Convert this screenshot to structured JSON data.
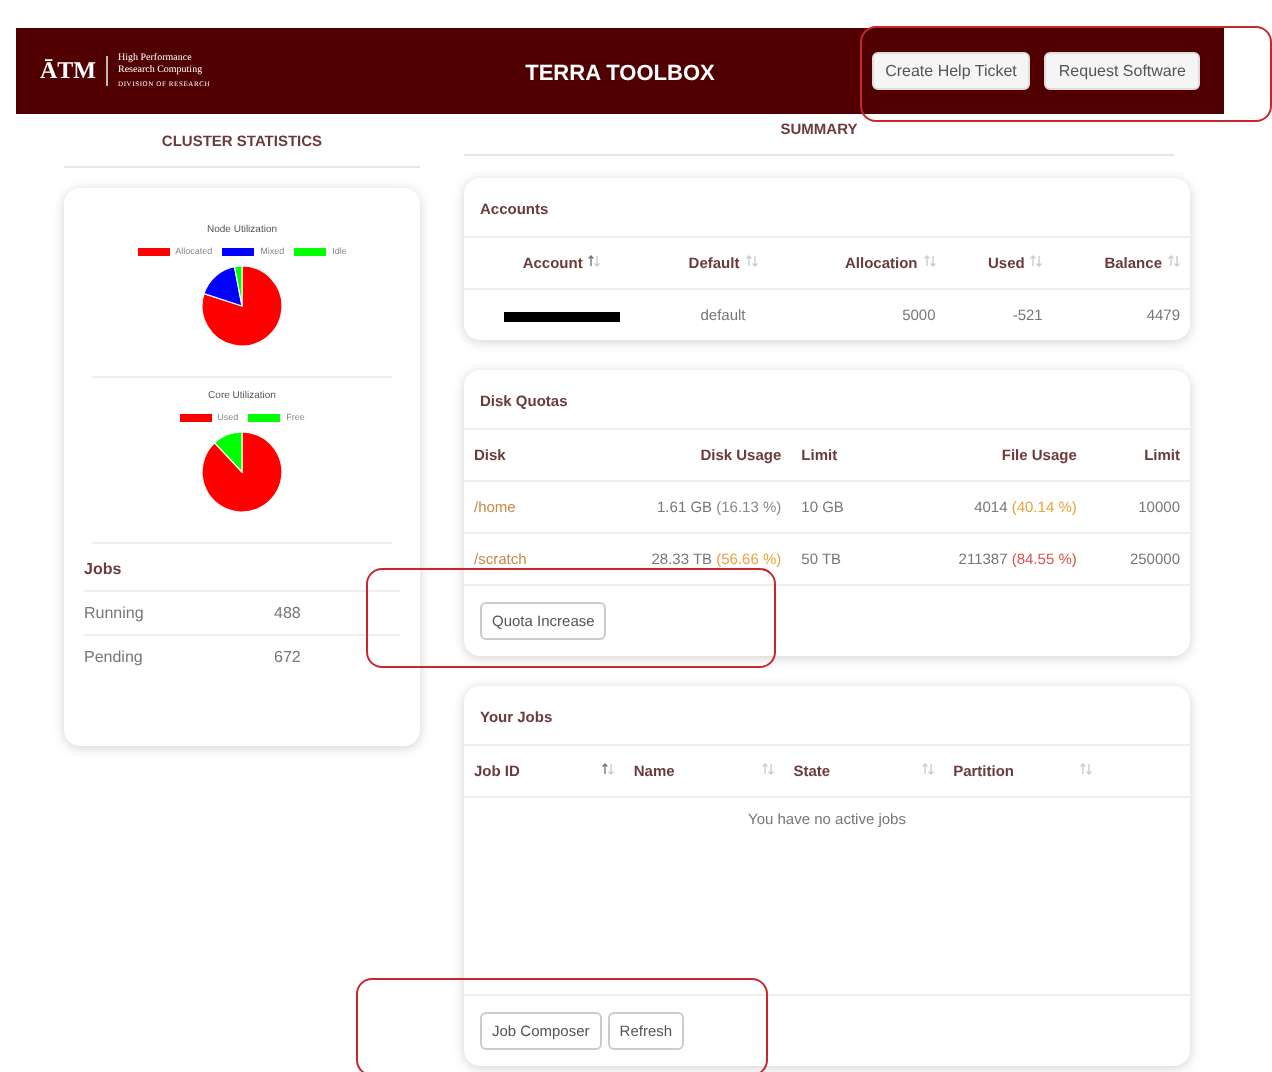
{
  "header": {
    "logo_mark": "ĀTM",
    "logo_lines": [
      "High Performance",
      "Research Computing"
    ],
    "logo_subline": "DIVISION OF RESEARCH",
    "title": "TERRA TOOLBOX",
    "buttons": [
      "Create Help Ticket",
      "Request Software"
    ]
  },
  "cluster_statistics": {
    "heading": "CLUSTER STATISTICS",
    "charts": [
      {
        "title": "Node Utilization",
        "legend": [
          {
            "label": "Allocated",
            "color": "#ff0000"
          },
          {
            "label": "Mixed",
            "color": "#0000ff"
          },
          {
            "label": "Idle",
            "color": "#00ff00"
          }
        ]
      },
      {
        "title": "Core Utilization",
        "legend": [
          {
            "label": "Used",
            "color": "#ff0000"
          },
          {
            "label": "Free",
            "color": "#00ff00"
          }
        ]
      }
    ],
    "jobs": {
      "title": "Jobs",
      "rows": [
        {
          "label": "Running",
          "value": "488"
        },
        {
          "label": "Pending",
          "value": "672"
        }
      ]
    }
  },
  "summary": {
    "heading": "SUMMARY",
    "accounts": {
      "title": "Accounts",
      "columns": [
        {
          "label": "Account",
          "sorted": true
        },
        {
          "label": "Default",
          "sorted": false
        },
        {
          "label": "Allocation",
          "sorted": false
        },
        {
          "label": "Used",
          "sorted": false
        },
        {
          "label": "Balance",
          "sorted": false
        }
      ],
      "rows": [
        {
          "account_redacted": true,
          "default": "default",
          "allocation": "5000",
          "used": "-521",
          "balance": "4479"
        }
      ]
    },
    "disk_quotas": {
      "title": "Disk Quotas",
      "columns": [
        "Disk",
        "Disk Usage",
        "Limit",
        "File Usage",
        "Limit"
      ],
      "rows": [
        {
          "disk": "/home",
          "disk_usage": "1.61 GB",
          "disk_pct": {
            "text": "(16.13 %)",
            "color": "#8a8a8a"
          },
          "disk_limit": "10 GB",
          "file_usage": "4014",
          "file_pct": {
            "text": "(40.14 %)",
            "color": "#e8a33c"
          },
          "file_limit": "10000"
        },
        {
          "disk": "/scratch",
          "disk_usage": "28.33 TB",
          "disk_pct": {
            "text": "(56.66 %)",
            "color": "#e8a33c"
          },
          "disk_limit": "50 TB",
          "file_usage": "211387",
          "file_pct": {
            "text": "(84.55 %)",
            "color": "#d9534f"
          },
          "file_limit": "250000"
        }
      ],
      "buttons": [
        "Quota Increase"
      ]
    },
    "your_jobs": {
      "title": "Your Jobs",
      "columns": [
        {
          "label": "Job ID",
          "sorted": true
        },
        {
          "label": "Name",
          "sorted": false
        },
        {
          "label": "State",
          "sorted": false
        },
        {
          "label": "Partition",
          "sorted": false
        }
      ],
      "empty_message": "You have no active jobs",
      "buttons": [
        "Job Composer",
        "Refresh"
      ]
    }
  }
}
